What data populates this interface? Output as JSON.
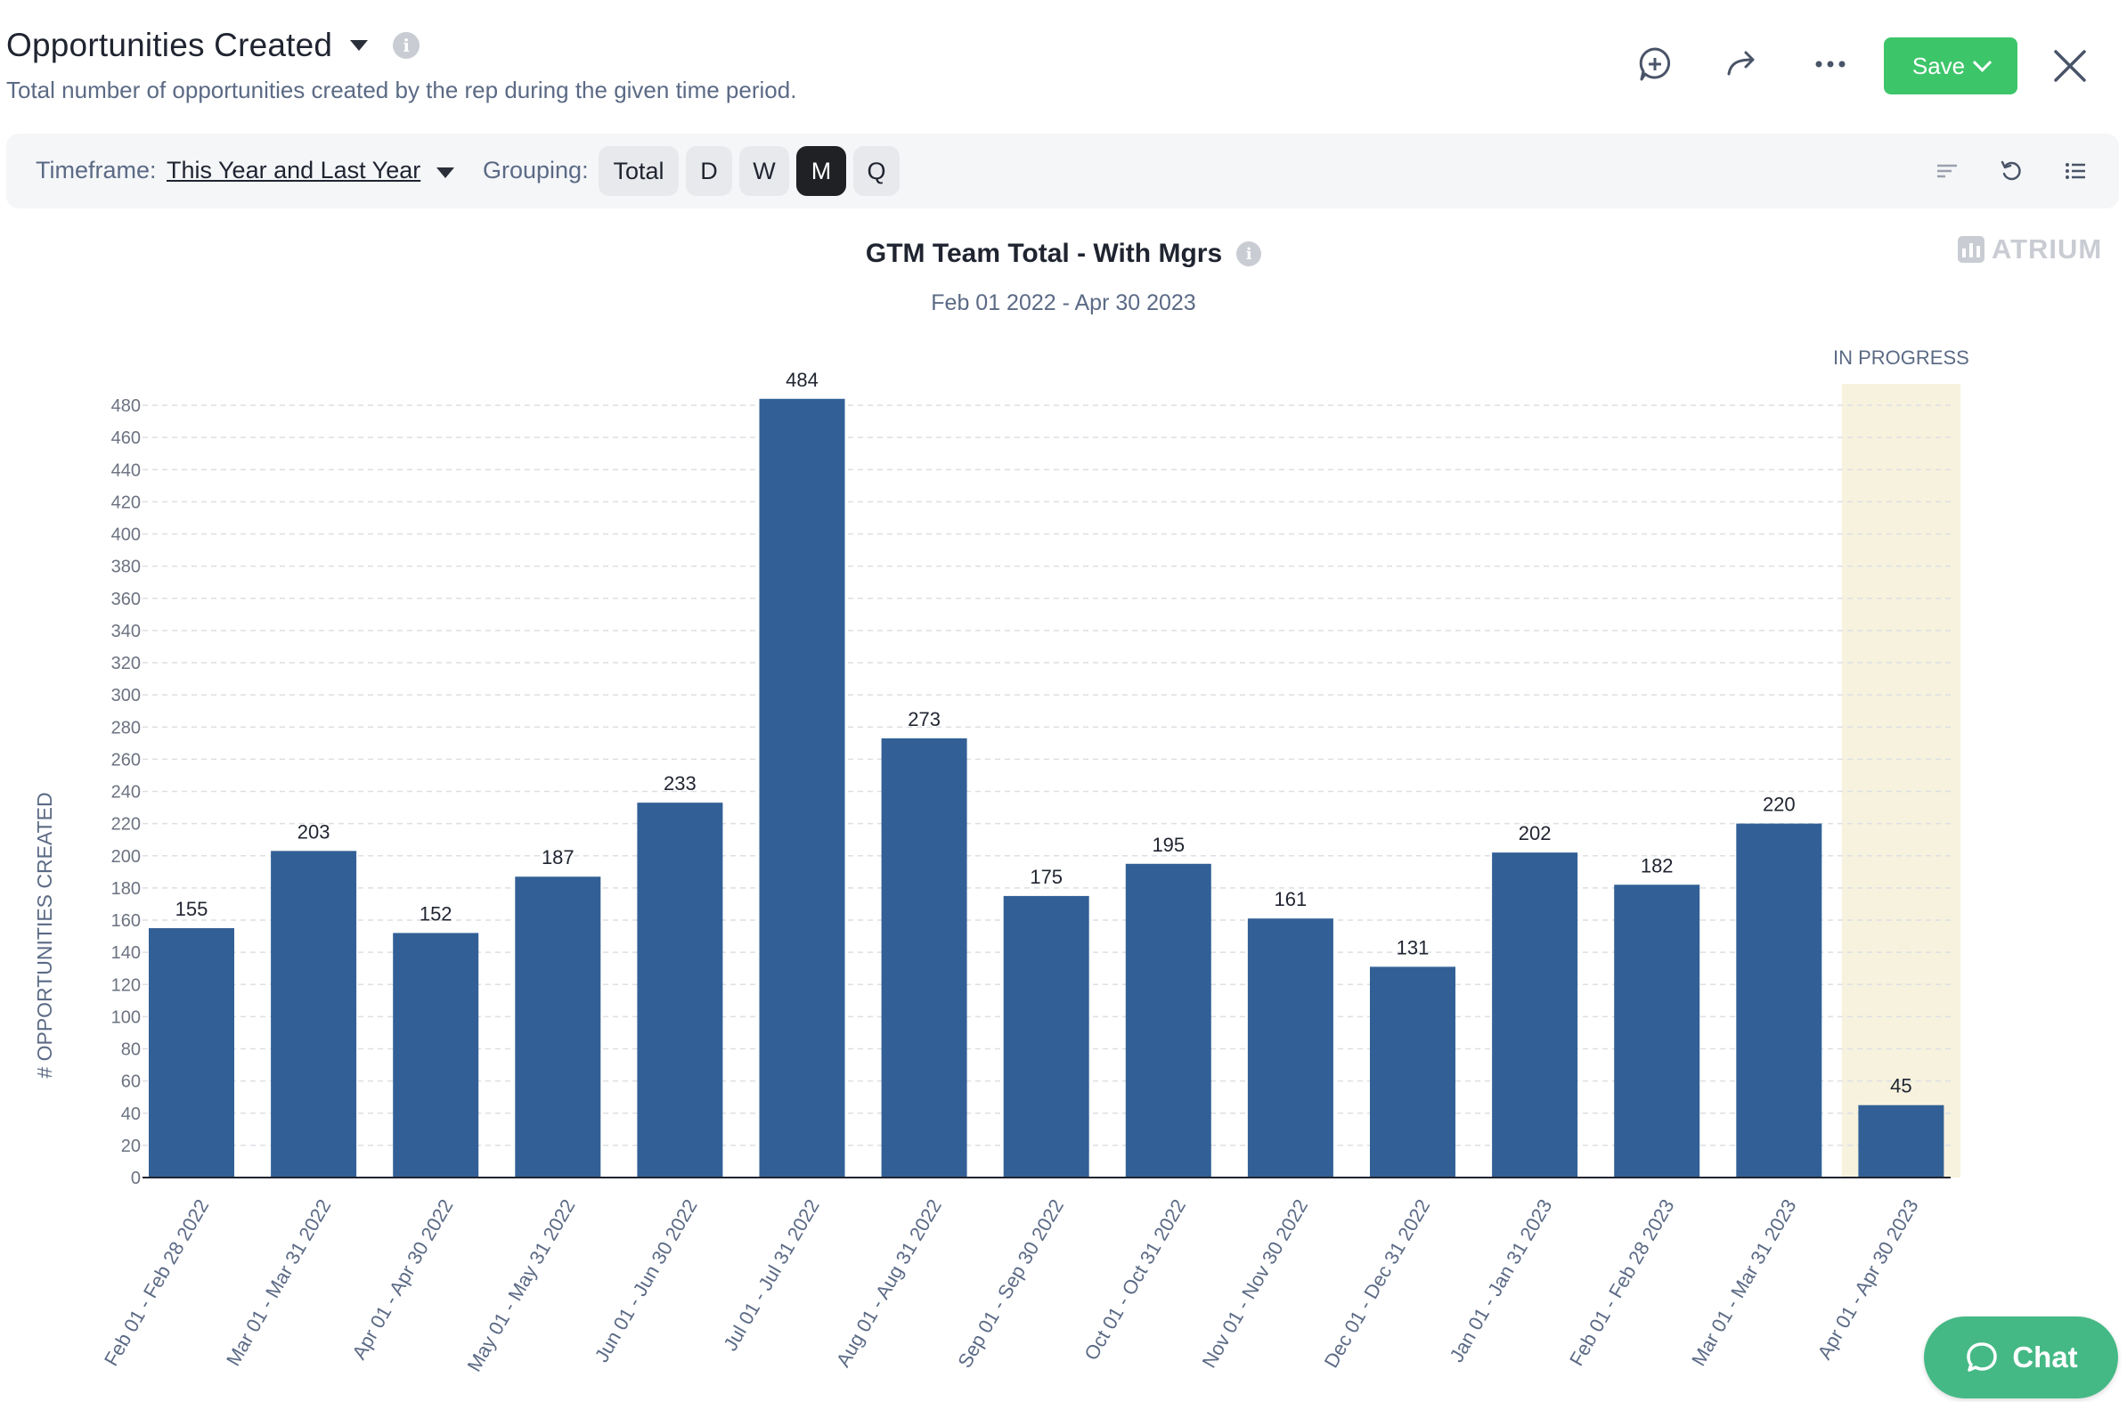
{
  "header": {
    "title": "Opportunities Created",
    "subtitle": "Total number of opportunities created by the rep during the given time period.",
    "save_label": "Save"
  },
  "toolbar": {
    "timeframe_label": "Timeframe:",
    "timeframe_value": "This Year and Last Year",
    "grouping_label": "Grouping:",
    "grouping_options": [
      "Total",
      "D",
      "W",
      "M",
      "Q"
    ],
    "grouping_selected": "M"
  },
  "brand": {
    "name": "ATRIUM"
  },
  "chat": {
    "label": "Chat"
  },
  "colors": {
    "bar": "#326096",
    "in_progress_band": "#f7f2dd",
    "save_green": "#3dc56a",
    "chat_green": "#45b985"
  },
  "chart_data": {
    "type": "bar",
    "title": "GTM Team Total - With Mgrs",
    "subtitle": "Feb 01 2022 - Apr 30 2023",
    "ylabel": "# OPPORTUNITIES CREATED",
    "xlabel": "",
    "ylim": [
      0,
      480
    ],
    "ytick_step": 20,
    "grid": true,
    "in_progress_label": "IN PROGRESS",
    "in_progress_index": 14,
    "categories": [
      "Feb 01 - Feb 28 2022",
      "Mar 01 - Mar 31 2022",
      "Apr 01 - Apr 30 2022",
      "May 01 - May 31 2022",
      "Jun 01 - Jun 30 2022",
      "Jul 01 - Jul 31 2022",
      "Aug 01 - Aug 31 2022",
      "Sep 01 - Sep 30 2022",
      "Oct 01 - Oct 31 2022",
      "Nov 01 - Nov 30 2022",
      "Dec 01 - Dec 31 2022",
      "Jan 01 - Jan 31 2023",
      "Feb 01 - Feb 28 2023",
      "Mar 01 - Mar 31 2023",
      "Apr 01 - Apr 30 2023"
    ],
    "values": [
      155,
      203,
      152,
      187,
      233,
      484,
      273,
      175,
      195,
      161,
      131,
      202,
      182,
      220,
      45
    ]
  }
}
